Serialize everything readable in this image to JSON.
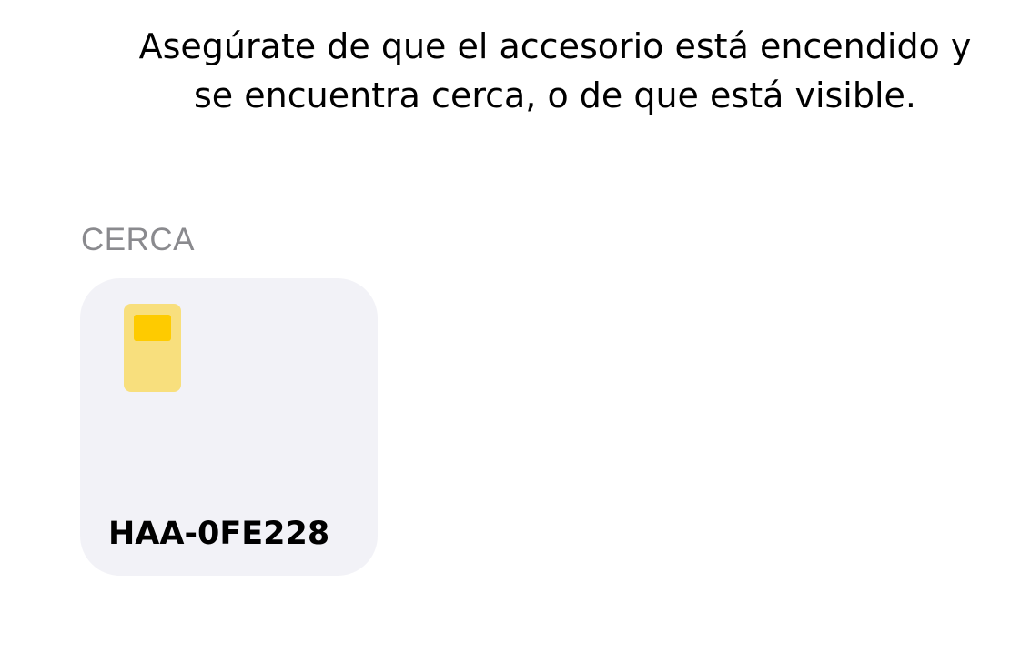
{
  "instructions": {
    "line1": "Asegúrate de que el accesorio está encendido y",
    "line2": "se encuentra cerca, o de que está visible."
  },
  "nearby": {
    "header": "CERCA",
    "accessories": [
      {
        "name": "HAA-0FE228",
        "icon": "accessory-device-icon",
        "colors": {
          "body": "#f8df7d",
          "screen": "#fecb00"
        }
      }
    ]
  },
  "colors": {
    "tile_background": "#f2f2f7",
    "section_header": "#8a8a8e",
    "text": "#000000"
  }
}
